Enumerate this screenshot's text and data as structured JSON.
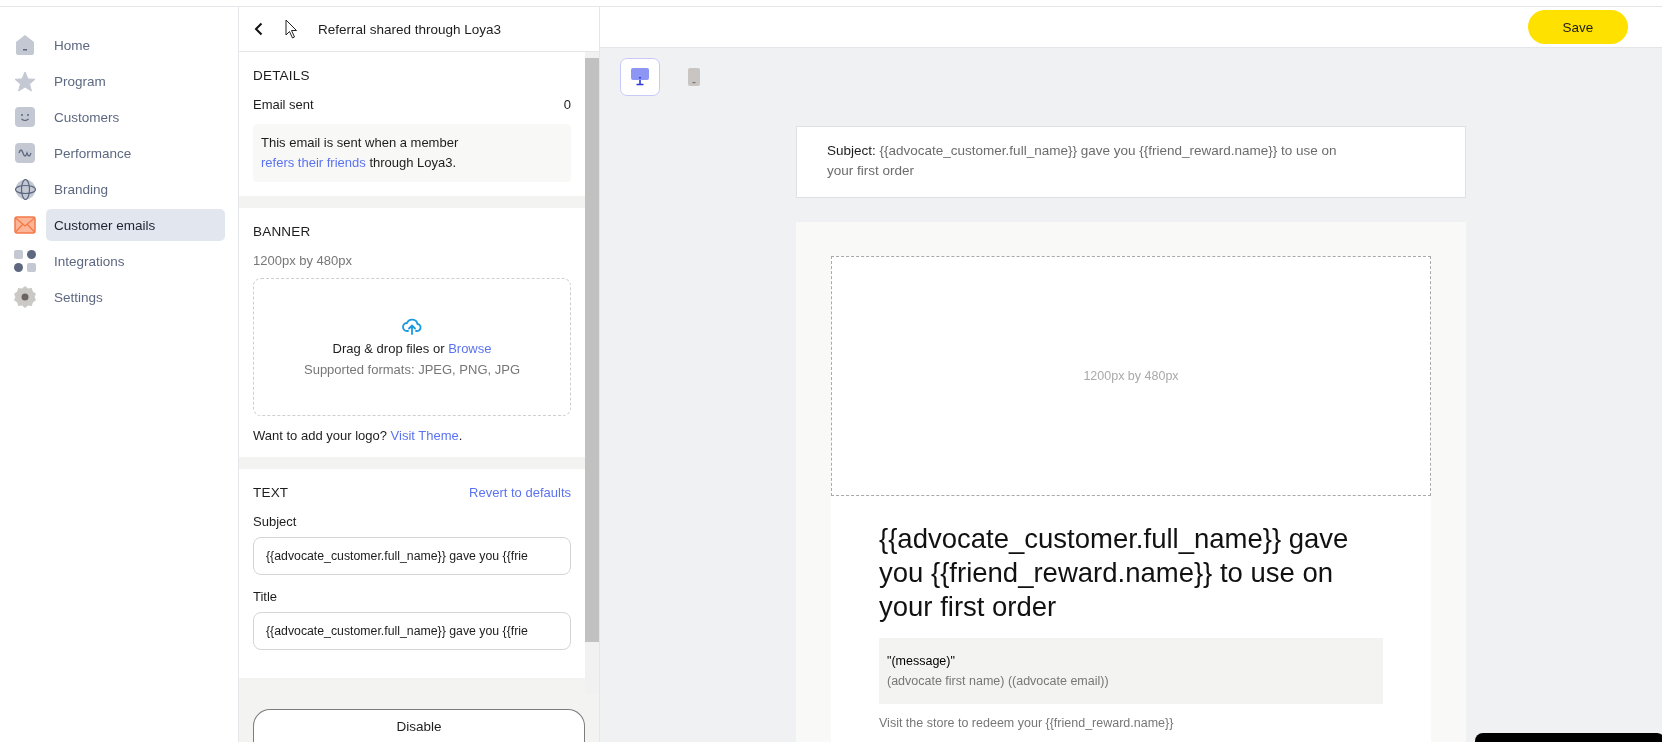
{
  "sidebar": {
    "items": [
      {
        "label": "Home",
        "kind": "home",
        "selected": false
      },
      {
        "label": "Program",
        "kind": "star",
        "selected": false
      },
      {
        "label": "Customers",
        "kind": "smile",
        "selected": false
      },
      {
        "label": "Performance",
        "kind": "wave",
        "selected": false
      },
      {
        "label": "Branding",
        "kind": "globe",
        "selected": false
      },
      {
        "label": "Customer emails",
        "kind": "mail",
        "selected": true
      },
      {
        "label": "Integrations",
        "kind": "grid",
        "selected": false
      },
      {
        "label": "Settings",
        "kind": "gear",
        "selected": false
      }
    ]
  },
  "editor": {
    "title": "Referral shared through Loya3",
    "details": {
      "heading": "DETAILS",
      "stat_label": "Email sent",
      "stat_value": "0",
      "note_before": "This email is sent when a member ",
      "note_link": "refers their friends",
      "note_after": " through Loya3."
    },
    "banner": {
      "heading": "BANNER",
      "size": "1200px by 480px",
      "drop_text": "Drag & drop files or ",
      "browse": "Browse",
      "formats": "Supported formats: JPEG, PNG, JPG",
      "logo_text": "Want to add your logo? ",
      "logo_link": "Visit Theme",
      "logo_end": "."
    },
    "text": {
      "heading": "TEXT",
      "revert": "Revert to defaults",
      "fields": [
        {
          "label": "Subject",
          "value": "{{advocate_customer.full_name}} gave you {{frie"
        },
        {
          "label": "Title",
          "value": "{{advocate_customer.full_name}} gave you {{frie"
        }
      ]
    },
    "footer_button": "Disable"
  },
  "toolbar": {
    "save": "Save"
  },
  "preview_modes": [
    {
      "kind": "desktop",
      "selected": true
    },
    {
      "kind": "mobile",
      "selected": false
    }
  ],
  "preview": {
    "subject_label": "Subject:",
    "subject": "{{advocate_customer.full_name}} gave you {{friend_reward.name}} to use on your first order",
    "banner_size": "1200px by 480px",
    "title": "{{advocate_customer.full_name}} gave you {{friend_reward.name}} to use on your first order",
    "message": "\"(message)\"",
    "signature": "(advocate first name) ((advocate email))",
    "body": "Visit the store to redeem your {{friend_reward.name}}"
  }
}
